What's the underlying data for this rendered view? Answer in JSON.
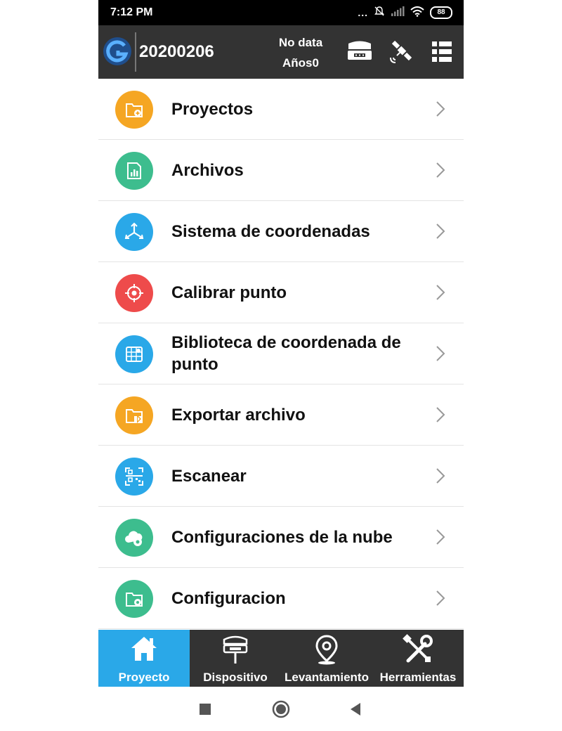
{
  "status_bar": {
    "time": "7:12 PM",
    "indicators": "...",
    "battery": "88"
  },
  "header": {
    "project_name": "20200206",
    "gps_status_line1": "No data",
    "gps_status_line2": "Años0",
    "icons": [
      "receiver-icon",
      "satellite-icon",
      "list-menu-icon"
    ]
  },
  "menu": {
    "items": [
      {
        "label": "Proyectos",
        "icon": "folder-add-icon",
        "color": "#f5a623"
      },
      {
        "label": "Archivos",
        "icon": "file-chart-icon",
        "color": "#3dbd8e"
      },
      {
        "label": "Sistema de coordenadas",
        "icon": "coordinate-axes-icon",
        "color": "#2aa8e8"
      },
      {
        "label": "Calibrar punto",
        "icon": "crosshair-icon",
        "color": "#ee4b4b"
      },
      {
        "label": "Biblioteca de coordenada de punto",
        "icon": "map-grid-icon",
        "color": "#2aa8e8"
      },
      {
        "label": "Exportar archivo",
        "icon": "folder-export-icon",
        "color": "#f5a623"
      },
      {
        "label": "Escanear",
        "icon": "qr-scan-icon",
        "color": "#2aa8e8"
      },
      {
        "label": "Configuraciones de la nube",
        "icon": "cloud-settings-icon",
        "color": "#3dbd8e"
      },
      {
        "label": "Configuracion",
        "icon": "folder-settings-icon",
        "color": "#3dbd8e"
      }
    ]
  },
  "bottom_nav": {
    "tabs": [
      {
        "label": "Proyecto",
        "icon": "home-icon",
        "active": true
      },
      {
        "label": "Dispositivo",
        "icon": "gnss-receiver-icon",
        "active": false
      },
      {
        "label": "Levantamiento",
        "icon": "location-pin-icon",
        "active": false
      },
      {
        "label": "Herramientas",
        "icon": "tools-icon",
        "active": false
      }
    ]
  },
  "system_nav": {
    "buttons": [
      "recents-button",
      "home-button",
      "back-button"
    ]
  },
  "colors": {
    "header_bg": "#333333",
    "accent": "#2aa8e8",
    "orange": "#f5a623",
    "green": "#3dbd8e",
    "red": "#ee4b4b"
  }
}
